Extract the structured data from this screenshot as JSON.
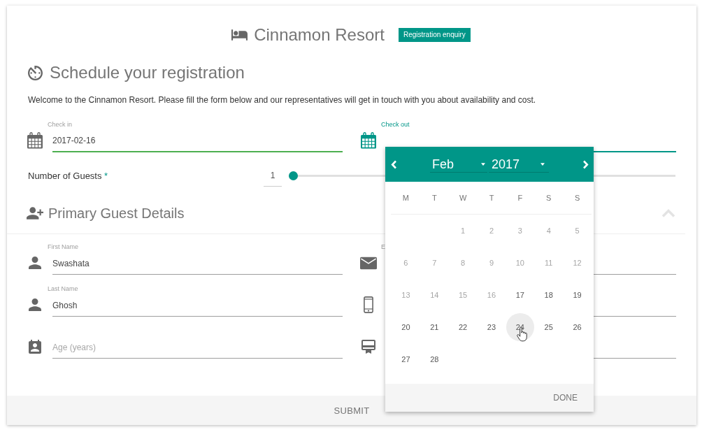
{
  "header": {
    "title": "Cinnamon Resort",
    "badge": "Registration enquiry"
  },
  "schedule": {
    "title": "Schedule your registration",
    "intro": "Welcome to the Cinnamon Resort. Please fill the form below and our representatives will get in touch with you about availability and cost.",
    "dates": [
      {
        "label": "Check in",
        "value": "2017-02-16",
        "valid": true,
        "focused": false
      },
      {
        "label": "Check out",
        "valid": false,
        "focused": true
      }
    ],
    "guests": {
      "label": "Number of Guests",
      "required_mark": "*",
      "value": "1",
      "level": 0
    }
  },
  "guest_details": {
    "title": "Primary Guest Details",
    "expanded": true,
    "columns": [
      {
        "fields": [
          {
            "kind": "name",
            "label": "First Name",
            "value": "Swashata"
          },
          {
            "kind": "name",
            "label": "Last Name",
            "value": "Ghosh"
          },
          {
            "kind": "age",
            "placeholder": "Age (years)"
          }
        ]
      },
      {
        "fields": [
          {
            "kind": "email",
            "label": "E"
          },
          {
            "kind": "phone"
          },
          {
            "kind": "membership"
          }
        ]
      }
    ]
  },
  "submit": "SUBMIT",
  "datepicker": {
    "month": "Feb",
    "year": "2017",
    "weekdays": [
      "M",
      "T",
      "W",
      "T",
      "F",
      "S",
      "S"
    ],
    "weeks": [
      {
        "days": [
          {
            "day": "1",
            "disabled": true,
            "hovered": false
          },
          {
            "day": "2",
            "disabled": true,
            "hovered": false
          },
          {
            "day": "3",
            "disabled": true,
            "hovered": false
          },
          {
            "day": "4",
            "disabled": true,
            "hovered": false
          },
          {
            "day": "5",
            "disabled": true,
            "hovered": false
          }
        ]
      },
      {
        "days": [
          {
            "day": "6",
            "disabled": true,
            "hovered": false
          },
          {
            "day": "7",
            "disabled": true,
            "hovered": false
          },
          {
            "day": "8",
            "disabled": true,
            "hovered": false
          },
          {
            "day": "9",
            "disabled": true,
            "hovered": false
          },
          {
            "day": "10",
            "disabled": true,
            "hovered": false
          },
          {
            "day": "11",
            "disabled": true,
            "hovered": false
          },
          {
            "day": "12",
            "disabled": true,
            "hovered": false
          }
        ]
      },
      {
        "days": [
          {
            "day": "13",
            "disabled": true,
            "hovered": false
          },
          {
            "day": "14",
            "disabled": true,
            "hovered": false
          },
          {
            "day": "15",
            "disabled": true,
            "hovered": false
          },
          {
            "day": "16",
            "disabled": true,
            "hovered": false
          },
          {
            "day": "17",
            "disabled": false,
            "hovered": false
          },
          {
            "day": "18",
            "disabled": false,
            "hovered": false
          },
          {
            "day": "19",
            "disabled": false,
            "hovered": false
          }
        ]
      },
      {
        "days": [
          {
            "day": "20",
            "disabled": false,
            "hovered": false
          },
          {
            "day": "21",
            "disabled": false,
            "hovered": false
          },
          {
            "day": "22",
            "disabled": false,
            "hovered": false
          },
          {
            "day": "23",
            "disabled": false,
            "hovered": false
          },
          {
            "day": "24",
            "disabled": false,
            "hovered": true
          },
          {
            "day": "25",
            "disabled": false,
            "hovered": false
          },
          {
            "day": "26",
            "disabled": false,
            "hovered": false
          }
        ]
      },
      {
        "days": [
          {
            "day": "27",
            "disabled": false,
            "hovered": false
          },
          {
            "day": "28",
            "disabled": false,
            "hovered": false
          }
        ]
      }
    ],
    "done": "DONE"
  }
}
